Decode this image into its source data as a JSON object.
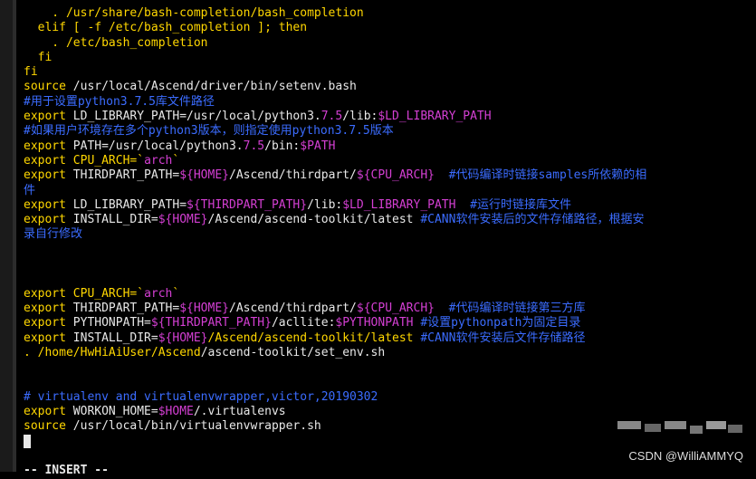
{
  "terminal": {
    "lines": [
      [
        {
          "t": "    . /usr/share/bash-completion/bash_completion",
          "c": "kw"
        }
      ],
      [
        {
          "t": "  elif [ -f /etc/bash_completion ]; ",
          "c": "kw"
        },
        {
          "t": "then",
          "c": "kw"
        }
      ],
      [
        {
          "t": "    . /etc/bash_completion",
          "c": "kw"
        }
      ],
      [
        {
          "t": "  fi",
          "c": "kw"
        }
      ],
      [
        {
          "t": "fi",
          "c": "kw"
        }
      ],
      [
        {
          "t": "source",
          "c": "kw"
        },
        {
          "t": " /usr/local/Ascend/driver/bin/setenv.bash",
          "c": "txt"
        }
      ],
      [
        {
          "t": "#用于设置python3.7.5库文件路径",
          "c": "cm"
        }
      ],
      [
        {
          "t": "export",
          "c": "kw"
        },
        {
          "t": " LD_LIBRARY_PATH=/usr/local/python3.",
          "c": "txt"
        },
        {
          "t": "7.5",
          "c": "num"
        },
        {
          "t": "/lib:",
          "c": "txt"
        },
        {
          "t": "$LD_LIBRARY_PATH",
          "c": "var"
        }
      ],
      [
        {
          "t": "#如果用户环境存在多个python3版本，则指定使用python3.7.5版本",
          "c": "cm"
        }
      ],
      [
        {
          "t": "export",
          "c": "kw"
        },
        {
          "t": " PATH=/usr/local/python3.",
          "c": "txt"
        },
        {
          "t": "7.5",
          "c": "num"
        },
        {
          "t": "/bin:",
          "c": "txt"
        },
        {
          "t": "$PATH",
          "c": "var"
        }
      ],
      [
        {
          "t": "export",
          "c": "kw"
        },
        {
          "t": " CPU_ARCH=`",
          "c": "kw"
        },
        {
          "t": "arch",
          "c": "str"
        },
        {
          "t": "`",
          "c": "kw"
        }
      ],
      [
        {
          "t": "export",
          "c": "kw"
        },
        {
          "t": " THIRDPART_PATH=",
          "c": "txt"
        },
        {
          "t": "${HOME}",
          "c": "var"
        },
        {
          "t": "/Ascend/thirdpart/",
          "c": "txt"
        },
        {
          "t": "${CPU_ARCH}",
          "c": "var"
        },
        {
          "t": "  #代码编译时链接samples所依赖的相",
          "c": "cm"
        }
      ],
      [
        {
          "t": "件",
          "c": "cm"
        }
      ],
      [
        {
          "t": "export",
          "c": "kw"
        },
        {
          "t": " LD_LIBRARY_PATH=",
          "c": "txt"
        },
        {
          "t": "${THIRDPART_PATH}",
          "c": "var"
        },
        {
          "t": "/lib:",
          "c": "txt"
        },
        {
          "t": "$LD_LIBRARY_PATH",
          "c": "var"
        },
        {
          "t": "  #运行时链接库文件",
          "c": "cm"
        }
      ],
      [
        {
          "t": "export",
          "c": "kw"
        },
        {
          "t": " INSTALL_DIR=",
          "c": "txt"
        },
        {
          "t": "${HOME}",
          "c": "var"
        },
        {
          "t": "/Ascend/ascend-toolkit/latest ",
          "c": "txt"
        },
        {
          "t": "#CANN软件安装后的文件存储路径，根据安",
          "c": "cm"
        }
      ],
      [
        {
          "t": "录自行修改",
          "c": "cm"
        }
      ],
      [],
      [],
      [],
      [
        {
          "t": "export",
          "c": "kw"
        },
        {
          "t": " CPU_ARCH=`",
          "c": "kw"
        },
        {
          "t": "arch",
          "c": "str"
        },
        {
          "t": "`",
          "c": "kw"
        }
      ],
      [
        {
          "t": "export",
          "c": "kw"
        },
        {
          "t": " THIRDPART_PATH=",
          "c": "txt"
        },
        {
          "t": "${HOME}",
          "c": "var"
        },
        {
          "t": "/Ascend/thirdpart/",
          "c": "txt"
        },
        {
          "t": "${CPU_ARCH}",
          "c": "var"
        },
        {
          "t": "  #代码编译时链接第三方库",
          "c": "cm"
        }
      ],
      [
        {
          "t": "export",
          "c": "kw"
        },
        {
          "t": " PYTHONPATH=",
          "c": "txt"
        },
        {
          "t": "${THIRDPART_PATH}",
          "c": "var"
        },
        {
          "t": "/acllite:",
          "c": "txt"
        },
        {
          "t": "$PYTHONPATH",
          "c": "var"
        },
        {
          "t": " #设置pythonpath为固定目录",
          "c": "cm"
        }
      ],
      [
        {
          "t": "export",
          "c": "kw"
        },
        {
          "t": " INSTALL_DIR=",
          "c": "txt"
        },
        {
          "t": "${HOME}",
          "c": "var"
        },
        {
          "t": "/Ascend/ascend-toolkit/latest ",
          "c": "kw"
        },
        {
          "t": "#CANN软件安装后文件存储路径",
          "c": "cm"
        }
      ],
      [
        {
          "t": ". /home/HwHiAiUser/",
          "c": "kw"
        },
        {
          "t": "Ascend",
          "c": "kw"
        },
        {
          "t": "/ascend-toolkit/set_env.sh",
          "c": "txt"
        }
      ],
      [],
      [],
      [
        {
          "t": "# virtualenv and virtualenvwrapper,victor,20190302",
          "c": "cm"
        }
      ],
      [
        {
          "t": "export",
          "c": "kw"
        },
        {
          "t": " WORKON_HOME=",
          "c": "txt"
        },
        {
          "t": "$HOME",
          "c": "var"
        },
        {
          "t": "/.virtualenvs",
          "c": "txt"
        }
      ],
      [
        {
          "t": "source",
          "c": "kw"
        },
        {
          "t": " /usr/local/bin/virtualenvwrapper.sh",
          "c": "txt"
        }
      ],
      [
        {
          "t": "CURSOR",
          "c": "cursor"
        }
      ],
      [],
      [
        {
          "t": "-- INSERT --",
          "c": "mode"
        }
      ]
    ]
  },
  "watermark": {
    "text": "CSDN @WilliAMMYQ"
  },
  "colors": {
    "keyword": "#ffd700",
    "comment": "#3b6cff",
    "variable": "#d43fd3",
    "text": "#e8e8e8",
    "background": "#000000"
  }
}
